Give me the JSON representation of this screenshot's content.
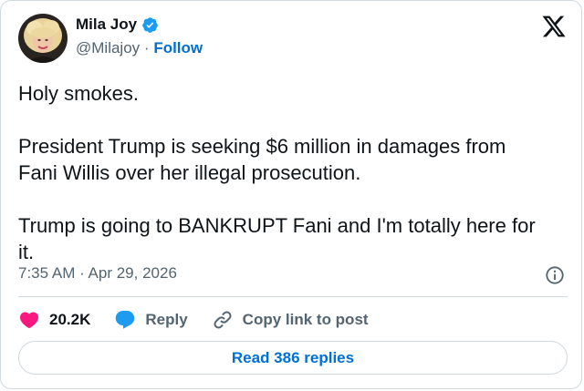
{
  "author": {
    "display_name": "Mila Joy",
    "handle": "@Milajoy",
    "separator": "·",
    "follow_label": "Follow"
  },
  "tweet": {
    "text": "Holy smokes.\n\nPresident Trump is seeking $6 million in damages from\nFani Willis over her illegal prosecution.\n\nTrump is going to BANKRUPT Fani and I'm totally here for\nit.",
    "timestamp": "7:35 AM · Apr 29, 2026"
  },
  "actions": {
    "likes_count": "20.2K",
    "reply_label": "Reply",
    "copy_link_label": "Copy link to post"
  },
  "footer": {
    "read_replies_label": "Read 386 replies"
  },
  "icons": {
    "logo": "x-logo-icon",
    "verified": "verified-badge-icon",
    "info": "info-icon",
    "like": "heart-icon",
    "reply": "speech-bubble-icon",
    "copy": "link-icon"
  },
  "colors": {
    "accent": "#1d9bf0",
    "link": "#006fd6",
    "heart": "#f91880",
    "text": "#0f1419",
    "muted": "#536471",
    "border": "#cfd9de"
  }
}
